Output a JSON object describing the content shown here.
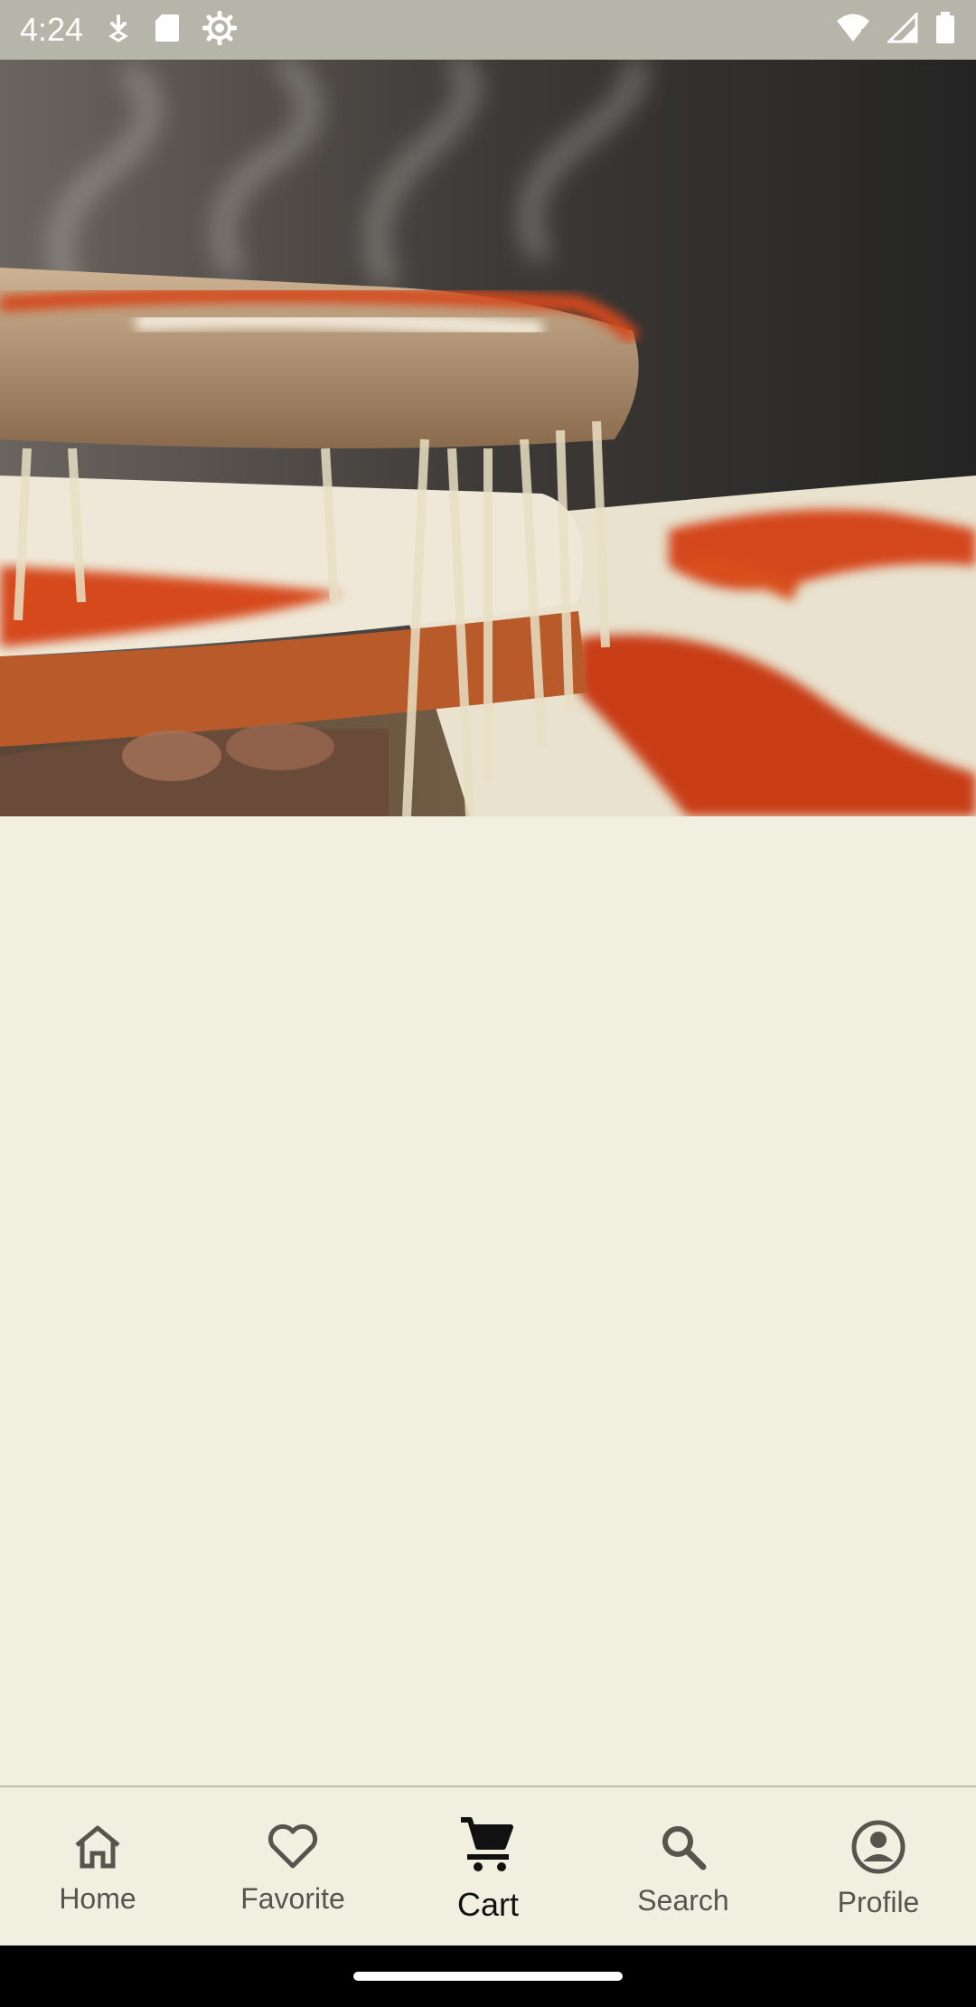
{
  "status_bar": {
    "time": "4:24",
    "icons_left": [
      "download-icon",
      "sd-card-icon",
      "settings-gear-icon"
    ],
    "icons_right": [
      "wifi-icon",
      "signal-icon",
      "battery-icon"
    ]
  },
  "hero": {
    "image": "pizza-slice-photo"
  },
  "bottom_nav": {
    "items": [
      {
        "label": "Home",
        "icon": "home-icon"
      },
      {
        "label": "Favorite",
        "icon": "heart-icon"
      },
      {
        "label": "Cart",
        "icon": "cart-icon",
        "active": true
      },
      {
        "label": "Search",
        "icon": "search-icon"
      },
      {
        "label": "Profile",
        "icon": "profile-icon"
      }
    ]
  },
  "colors": {
    "background": "#f1f0e0",
    "status_bar": "#b5b5aa",
    "nav_active": "#111111",
    "nav_inactive": "#56564f"
  }
}
